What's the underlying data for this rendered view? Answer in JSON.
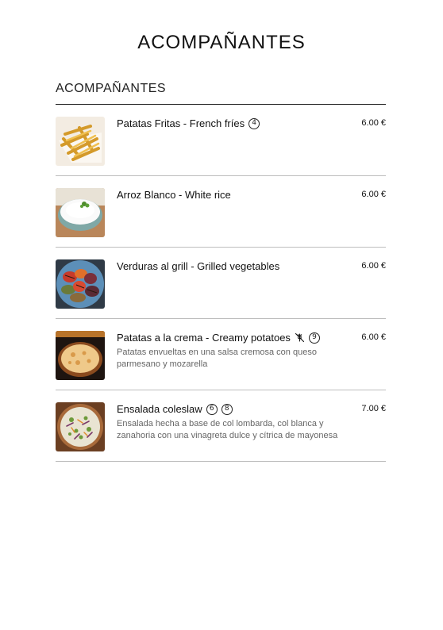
{
  "page": {
    "title": "ACOMPAÑANTES"
  },
  "section": {
    "title": "ACOMPAÑANTES"
  },
  "items": [
    {
      "name": "Patatas Fritas - French fríes",
      "description": "",
      "price": "6.00 €",
      "allergens": [
        "4"
      ],
      "diet_icon": null,
      "image": "french-fries"
    },
    {
      "name": "Arroz Blanco - White rice",
      "description": "",
      "price": "6.00 €",
      "allergens": [],
      "diet_icon": null,
      "image": "white-rice"
    },
    {
      "name": "Verduras al grill - Grilled vegetables",
      "description": "",
      "price": "6.00 €",
      "allergens": [],
      "diet_icon": null,
      "image": "grilled-vegetables"
    },
    {
      "name": "Patatas a la crema - Creamy potatoes",
      "description": "Patatas envueltas en una salsa cremosa con queso parmesano y mozarella",
      "price": "6.00 €",
      "allergens": [
        "9"
      ],
      "diet_icon": "no-gluten-icon",
      "image": "creamy-potatoes"
    },
    {
      "name": "Ensalada coleslaw",
      "description": "Ensalada hecha a base de col lombarda, col blanca y zanahoria con una vinagreta dulce y cítrica de mayonesa",
      "price": "7.00 €",
      "allergens": [
        "6",
        "8"
      ],
      "diet_icon": null,
      "image": "coleslaw-salad"
    }
  ]
}
